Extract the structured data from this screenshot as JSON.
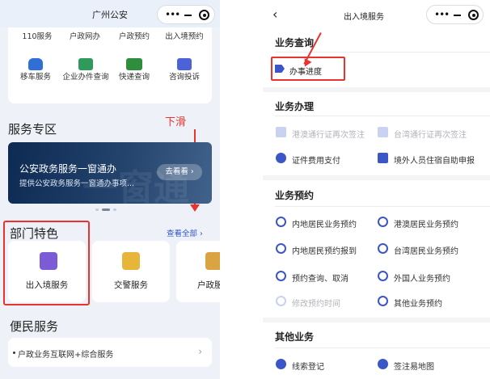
{
  "left": {
    "title": "广州公安",
    "capsule": {
      "more": "•••",
      "minimize": "—"
    },
    "top_services": [
      {
        "label": "110服务",
        "icon": "police-110-icon"
      },
      {
        "label": "户政网办",
        "icon": "household-online-icon"
      },
      {
        "label": "户政预约",
        "icon": "household-appointment-icon"
      },
      {
        "label": "出入境预约",
        "icon": "exit-entry-appointment-icon"
      },
      {
        "label": "移车服务",
        "icon": "car-move-icon"
      },
      {
        "label": "企业办件查询",
        "icon": "enterprise-query-icon"
      },
      {
        "label": "快递查询",
        "icon": "truck-icon"
      },
      {
        "label": "咨询投诉",
        "icon": "chat-icon"
      }
    ],
    "service_zone_title": "服务专区",
    "banner": {
      "headline": "公安政务服务一窗通办",
      "sub": "提供公安政务服务一窗通办事项...",
      "button": "去看看",
      "ghost_text": "一窗通办"
    },
    "annotation_scroll": "下滑",
    "dept_title": "部门特色",
    "see_all": "查看全部",
    "dept_cards": [
      {
        "label": "出入境服务",
        "icon": "exit-entry-icon"
      },
      {
        "label": "交警服务",
        "icon": "traffic-police-icon"
      },
      {
        "label": "户政服",
        "icon": "household-building-icon"
      }
    ],
    "convenience_title": "便民服务",
    "convenience_item": "户政业务互联网+综合服务"
  },
  "right": {
    "title": "出入境服务",
    "sections": [
      {
        "title": "业务查询",
        "items": [
          {
            "label": "办事进度",
            "disabled": false
          }
        ]
      },
      {
        "title": "业务办理",
        "items": [
          {
            "label": "港澳通行证再次签注",
            "disabled": true
          },
          {
            "label": "台湾通行证再次签注",
            "disabled": true
          },
          {
            "label": "证件费用支付",
            "disabled": false
          },
          {
            "label": "境外人员住宿自助申报",
            "disabled": false
          }
        ]
      },
      {
        "title": "业务预约",
        "items": [
          {
            "label": "内地居民业务预约",
            "disabled": false
          },
          {
            "label": "港澳居民业务预约",
            "disabled": false
          },
          {
            "label": "内地居民预约报到",
            "disabled": false
          },
          {
            "label": "台湾居民业务预约",
            "disabled": false
          },
          {
            "label": "预约查询、取消",
            "disabled": false
          },
          {
            "label": "外国人业务预约",
            "disabled": false
          },
          {
            "label": "修改预约时间",
            "disabled": true
          },
          {
            "label": "其他业务预约",
            "disabled": false
          }
        ]
      },
      {
        "title": "其他业务",
        "items": [
          {
            "label": "线索登记",
            "disabled": false
          },
          {
            "label": "签注易地图",
            "disabled": false
          }
        ]
      }
    ]
  },
  "colors": {
    "accent_blue": "#3b56c7",
    "annotation_red": "#e8332f",
    "link_blue": "#2f54c9"
  }
}
